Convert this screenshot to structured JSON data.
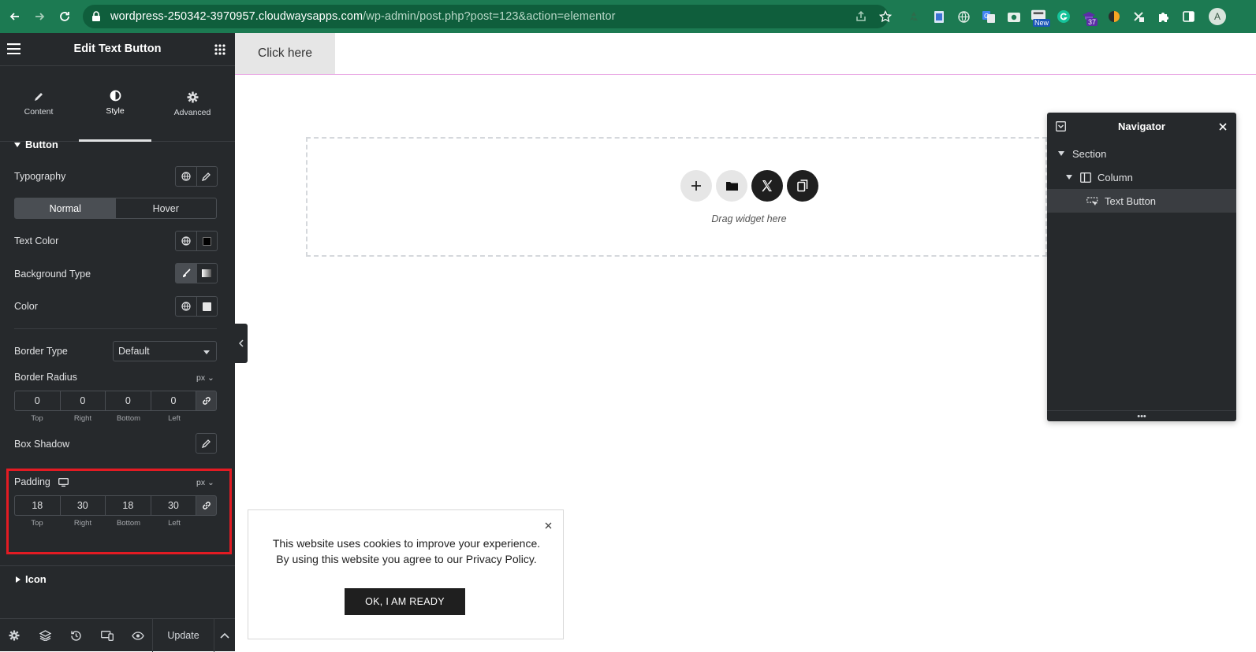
{
  "browser": {
    "url_host": "wordpress-250342-3970957.cloudwaysapps.com",
    "url_path": "/wp-admin/post.php?post=123&action=elementor",
    "ext_badge_count": "37",
    "ext_badge_new": "New",
    "avatar_letter": "A"
  },
  "panel": {
    "title": "Edit Text Button",
    "tabs": [
      {
        "label": "Content"
      },
      {
        "label": "Style"
      },
      {
        "label": "Advanced"
      }
    ],
    "section_button": "Button",
    "typography": "Typography",
    "state_toggle": {
      "normal": "Normal",
      "hover": "Hover"
    },
    "text_color": "Text Color",
    "background_type": "Background Type",
    "color": "Color",
    "border_type": {
      "label": "Border Type",
      "value": "Default"
    },
    "border_radius": {
      "label": "Border Radius",
      "unit": "px",
      "values": {
        "top": "0",
        "right": "0",
        "bottom": "0",
        "left": "0"
      },
      "labels": {
        "top": "Top",
        "right": "Right",
        "bottom": "Bottom",
        "left": "Left"
      }
    },
    "box_shadow": "Box Shadow",
    "padding": {
      "label": "Padding",
      "unit": "px",
      "values": {
        "top": "18",
        "right": "30",
        "bottom": "18",
        "left": "30"
      },
      "labels": {
        "top": "Top",
        "right": "Right",
        "bottom": "Bottom",
        "left": "Left"
      }
    },
    "section_icon": "Icon",
    "update_label": "Update"
  },
  "canvas": {
    "button_text": "Click here",
    "drag_text": "Drag widget here"
  },
  "navigator": {
    "title": "Navigator",
    "items": [
      {
        "label": "Section"
      },
      {
        "label": "Column"
      },
      {
        "label": "Text Button"
      }
    ]
  },
  "cookie": {
    "line1": "This website uses cookies to improve your experience.",
    "line2": "By using this website you agree to our Privacy Policy.",
    "button": "OK, I AM READY"
  },
  "colors": {
    "browser_bar": "#1c7a52",
    "panel_bg": "#26292c",
    "highlight": "#e31b23",
    "swatch_text_color": "#000000",
    "swatch_bg_color": "#e6e6e6"
  }
}
